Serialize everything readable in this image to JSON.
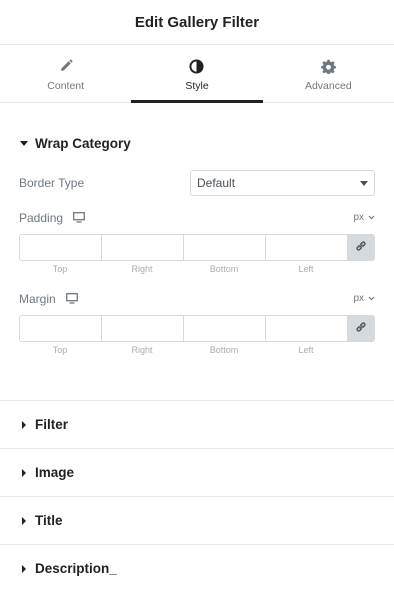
{
  "header": {
    "title": "Edit Gallery Filter"
  },
  "tabs": [
    {
      "label": "Content",
      "icon": "pencil-icon",
      "active": false
    },
    {
      "label": "Style",
      "icon": "contrast-icon",
      "active": true
    },
    {
      "label": "Advanced",
      "icon": "gear-icon",
      "active": false
    }
  ],
  "wrap_category": {
    "title": "Wrap Category",
    "border_type": {
      "label": "Border Type",
      "value": "Default"
    },
    "padding": {
      "label": "Padding",
      "unit": "px",
      "fields": [
        "Top",
        "Right",
        "Bottom",
        "Left"
      ],
      "values": [
        "",
        "",
        "",
        ""
      ]
    },
    "margin": {
      "label": "Margin",
      "unit": "px",
      "fields": [
        "Top",
        "Right",
        "Bottom",
        "Left"
      ],
      "values": [
        "",
        "",
        "",
        ""
      ]
    }
  },
  "collapsed_sections": [
    {
      "title": "Filter"
    },
    {
      "title": "Image"
    },
    {
      "title": "Title"
    },
    {
      "title": "Description_"
    }
  ],
  "colors": {
    "heading": "#1f2124",
    "muted": "#6d7882",
    "border": "#d5dadf",
    "link_bg": "#d5dadf"
  }
}
